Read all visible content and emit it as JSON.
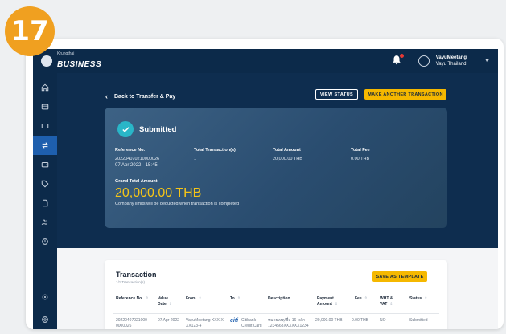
{
  "step_badge": "17",
  "brand": {
    "top": "Krungthai",
    "name": "BUSINESS"
  },
  "user": {
    "name": "VayuMeetang",
    "company": "Vayu Thailand"
  },
  "back_label": "Back to Transfer & Pay",
  "buttons": {
    "view_status": "VIEW STATUS",
    "make_another": "MAKE ANOTHER TRANSACTION",
    "save_template": "SAVE AS TEMPLATE"
  },
  "summary": {
    "status": "Submitted",
    "reference_label": "Reference No.",
    "reference_value": "202204070210000026",
    "date": "07 Apr 2022 - 15:45",
    "total_txn_label": "Total Transaction(s)",
    "total_txn_value": "1",
    "total_amount_label": "Total Amount",
    "total_amount_value": "20,000.00 THB",
    "total_fee_label": "Total Fee",
    "total_fee_value": "0.00 THB",
    "grand_total_label": "Grand Total Amount",
    "grand_total_value": "20,000.00 THB",
    "note": "Company limits will be deducted when transaction is completed"
  },
  "transaction": {
    "title": "Transaction",
    "subtitle": "1/1 Transaction(s)",
    "headers": [
      "Reference No.",
      "Value Date",
      "From",
      "To",
      "Description",
      "Payment Amount",
      "Fee",
      "WHT & VAT",
      "Status"
    ],
    "row": {
      "ref": "20220407021000 0000026",
      "date": "07 Apr 2022",
      "from": "VayuMeetang XXX-X-XX123-4",
      "to_logo": "citi",
      "to": "Citibank Credit Card 6047",
      "description": "หมายเหตุ/ชื่อ 16 หลัก 1234568XXXXXX1234",
      "amount": "20,000.00 THB",
      "fee": "0.00 THB",
      "wht": "NO",
      "status": "Submitted"
    }
  },
  "icons": [
    "home-icon",
    "account-icon",
    "card-icon",
    "transfer-icon",
    "wallet-icon",
    "tag-icon",
    "document-icon",
    "users-icon",
    "history-icon",
    "settings-icon",
    "help-icon"
  ]
}
